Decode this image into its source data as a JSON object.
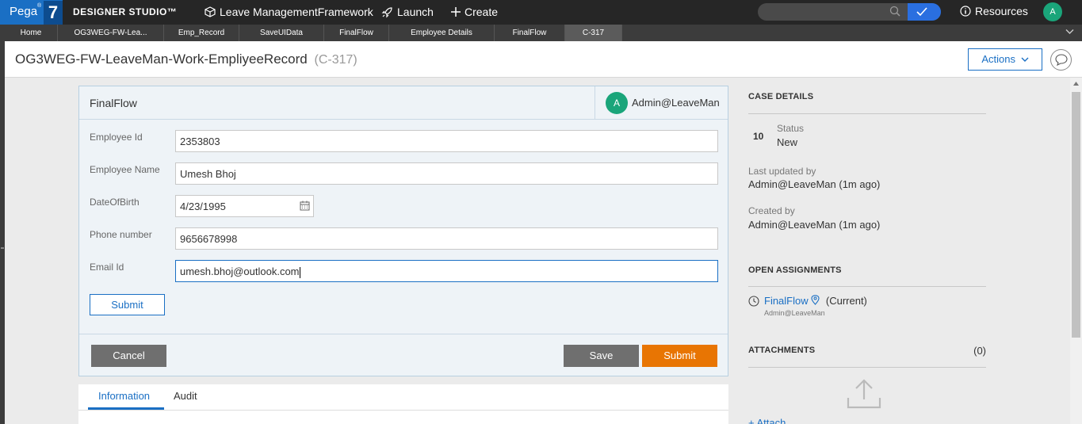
{
  "topbar": {
    "logo": "Pega",
    "logo_reg": "®",
    "logo_version": "7",
    "studio": "DESIGNER STUDIO™",
    "app_name": "Leave ManagementFramework",
    "launch": "Launch",
    "create": "Create",
    "search_placeholder": "",
    "resources": "Resources",
    "avatar": "A"
  },
  "tabs": [
    "Home",
    "OG3WEG-FW-Lea...",
    "Emp_Record",
    "SaveUIData",
    "FinalFlow",
    "Employee Details",
    "FinalFlow",
    "C-317"
  ],
  "case": {
    "title": "OG3WEG-FW-LeaveMan-Work-EmpliyeeRecord",
    "id": "(C-317)",
    "actions": "Actions"
  },
  "panel": {
    "title": "FinalFlow",
    "user_avatar": "A",
    "user": "Admin@LeaveMan",
    "fields": [
      {
        "label": "Employee Id",
        "value": "2353803"
      },
      {
        "label": "Employee Name",
        "value": "Umesh Bhoj"
      },
      {
        "label": "DateOfBirth",
        "value": "4/23/1995"
      },
      {
        "label": "Phone number",
        "value": "9656678998"
      },
      {
        "label": "Email Id",
        "value": "umesh.bhoj@outlook.com"
      }
    ],
    "submit_inline": "Submit",
    "cancel": "Cancel",
    "save": "Save",
    "submit": "Submit"
  },
  "bottom_tabs": [
    "Information",
    "Audit"
  ],
  "side": {
    "case_details": "CASE DETAILS",
    "status_num": "10",
    "status_label": "Status",
    "status_value": "New",
    "last_updated_label": "Last updated by",
    "last_updated_value": "Admin@LeaveMan (1m ago)",
    "created_label": "Created by",
    "created_value": "Admin@LeaveMan (1m ago)",
    "open_assignments": "OPEN ASSIGNMENTS",
    "assignment_name": "FinalFlow",
    "assignment_current": "(Current)",
    "assignment_user": "Admin@LeaveMan",
    "attachments": "ATTACHMENTS",
    "attachments_count": "(0)",
    "attach_link": "+ Attach"
  },
  "colors": {
    "brand": "#1a6fc4",
    "submit": "#e87503",
    "secondary": "#6f6f6f",
    "avatar": "#1aa57a"
  }
}
